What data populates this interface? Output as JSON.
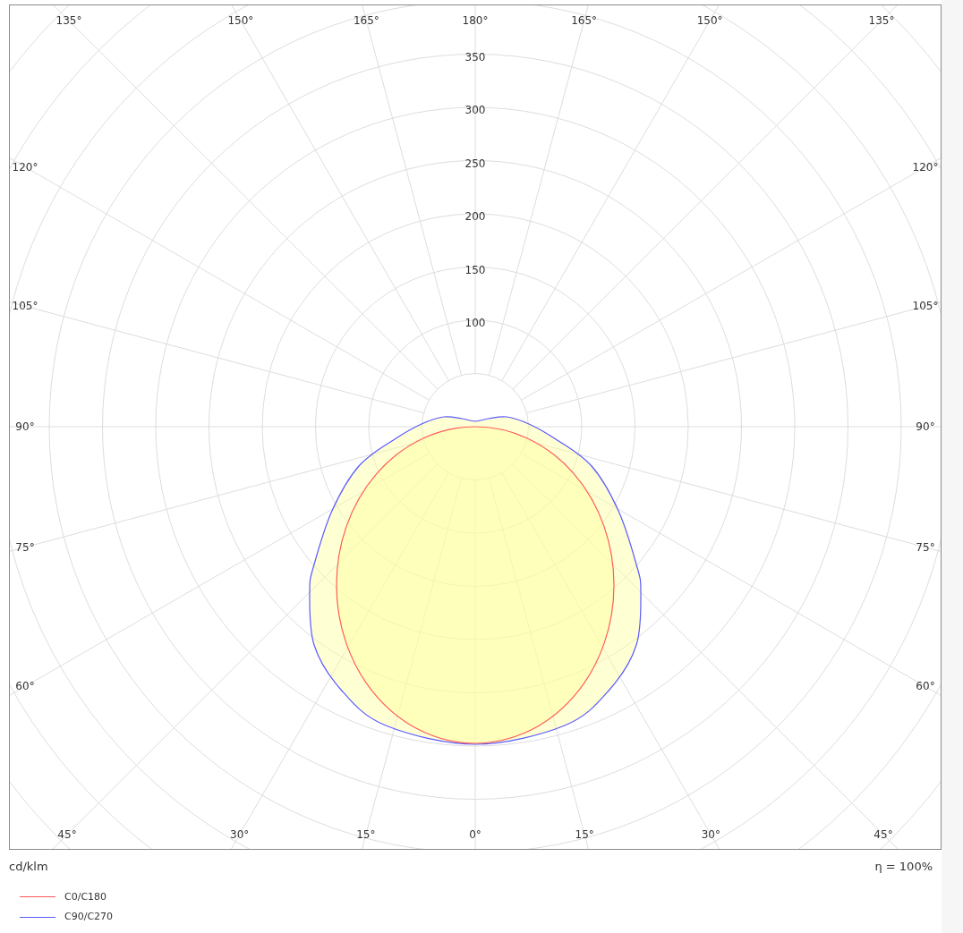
{
  "diagram": {
    "angle_labels": [
      "135°",
      "150°",
      "165°",
      "180°",
      "165°",
      "150°",
      "135°",
      "120°",
      "120°",
      "105°",
      "105°",
      "90°",
      "90°",
      "75°",
      "75°",
      "60°",
      "60°",
      "45°",
      "30°",
      "15°",
      "0°",
      "15°",
      "30°",
      "45°"
    ],
    "ring_labels": [
      "350",
      "300",
      "250",
      "200",
      "150",
      "100"
    ]
  },
  "unit": "cd/klm",
  "efficiency": "η = 100%",
  "legend": [
    {
      "name": "C0/C180",
      "color": "#ff5a5a"
    },
    {
      "name": "C90/C270",
      "color": "#5a5aff"
    }
  ]
}
